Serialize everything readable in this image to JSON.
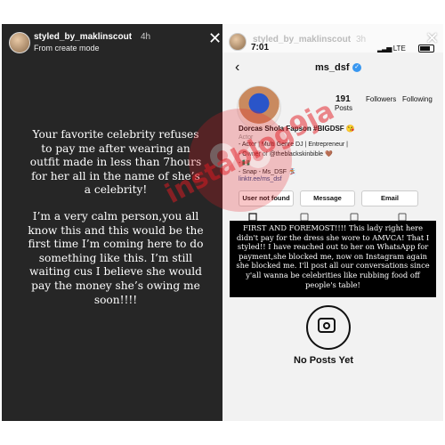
{
  "left_story": {
    "username": "styled_by_maklinscout",
    "time": "4h",
    "subtitle": "From create mode",
    "close_glyph": "✕",
    "paragraphs": [
      "Your favorite celebrity refuses to pay me after wearing an outfit made in less than 7hours for her all in the name of she’s a celebrity!",
      "I’m a very calm person,you all know this and this would be the first time I’m coming here to do something like this. I’m still waiting cus I believe she would pay the money she’s owing me soon!!!!"
    ]
  },
  "right_story": {
    "username": "styled_by_maklinscout",
    "time": "3h",
    "close_glyph": "✕",
    "status_bar": {
      "time": "7:01",
      "network": "LTE"
    },
    "profile": {
      "back_glyph": "‹",
      "handle": "ms_dsf",
      "verified_glyph": "✓",
      "stats": {
        "posts_count": "191",
        "posts_label": "Posts",
        "followers_label": "Followers",
        "following_label": "Following"
      },
      "bio": {
        "name": "Dorcas Shola Fapson #BIGDSF 😘",
        "category": "Actor",
        "lines": [
          "- Actor | Multi Genre DJ | Entrepreneur |",
          "- Owner of @theblackskinbible 🤎",
          "- 🇳🇬",
          "- Snap - Ms_DSF 🏂"
        ],
        "link": "linktr.ee/ms_dsf"
      },
      "buttons": {
        "user": "User not found",
        "message": "Message",
        "email": "Email"
      }
    },
    "notice_text": "FIRST AND FOREMOST!!!! This lady right here didn't pay for the dress she wore to AMVCA! That I styled!! I have reached out to her on WhatsApp for payment,she blocked me, now on Instagram again she blocked me. I'll post all our conversations since y'all wanna be celebrities like rubbing food off people's table!",
    "no_posts": "No Posts Yet"
  },
  "watermark": {
    "text": "instablog9ja",
    "color": "#e31b23"
  }
}
